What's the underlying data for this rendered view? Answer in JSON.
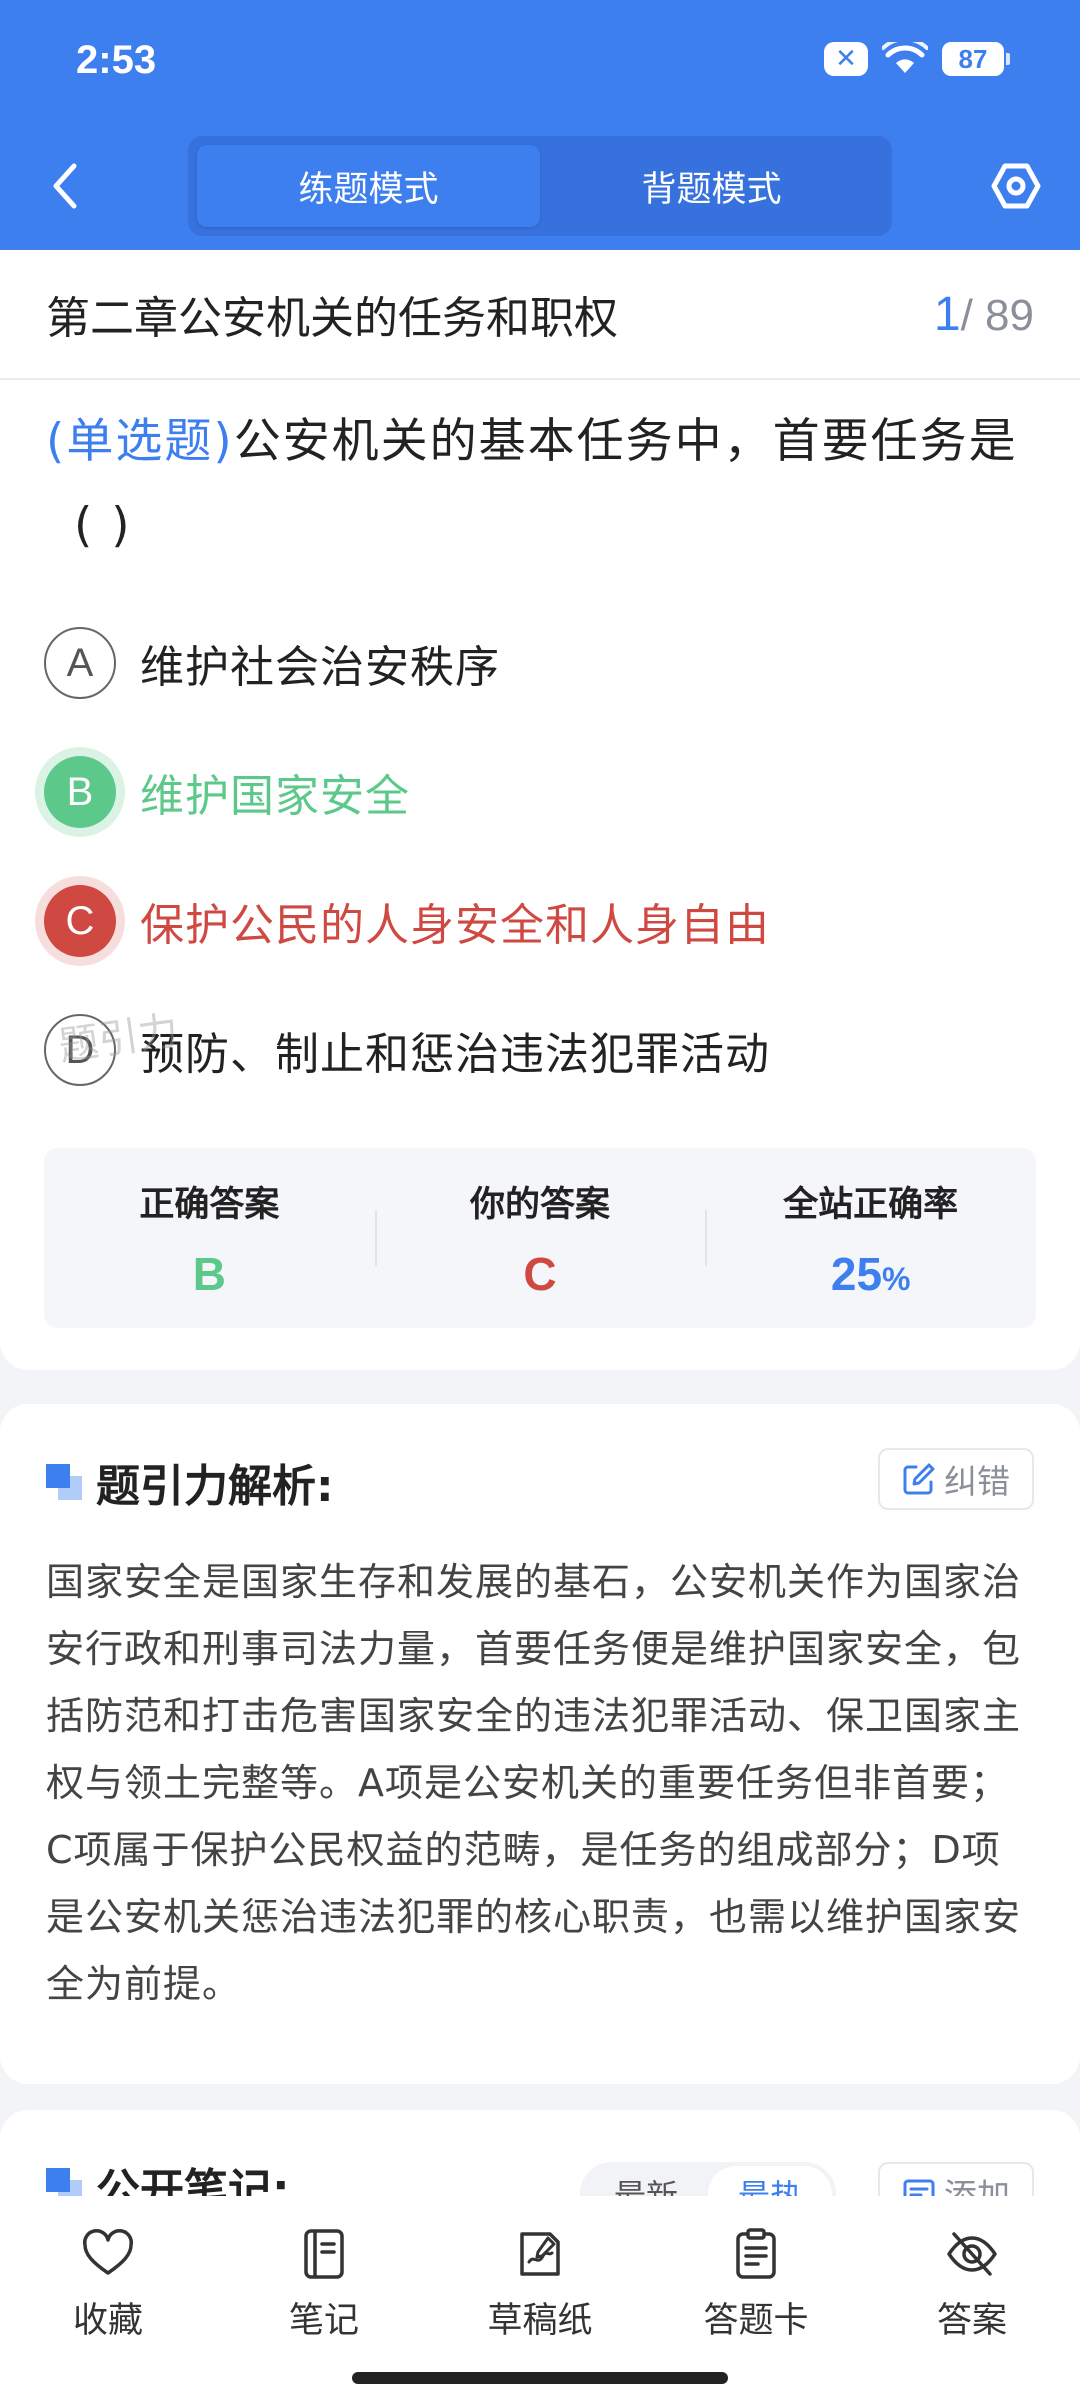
{
  "status_bar": {
    "time": "2:53",
    "dnd_symbol": "✕",
    "battery": "87"
  },
  "header": {
    "modes": [
      {
        "label": "练题模式",
        "active": true
      },
      {
        "label": "背题模式",
        "active": false
      }
    ]
  },
  "chapter": {
    "title": "第二章公安机关的任务和职权",
    "current": "1",
    "total": "/ 89"
  },
  "question": {
    "type": "(单选题)",
    "text": "公安机关的基本任务中，首要任务是",
    "blank": "(        )",
    "options": [
      {
        "letter": "A",
        "text": "维护社会治安秩序",
        "state": "normal"
      },
      {
        "letter": "B",
        "text": "维护国家安全",
        "state": "correct"
      },
      {
        "letter": "C",
        "text": "保护公民的人身安全和人身自由",
        "state": "wrong"
      },
      {
        "letter": "D",
        "text": "预防、制止和惩治违法犯罪活动",
        "state": "normal"
      }
    ]
  },
  "stats": {
    "correct_label": "正确答案",
    "correct_value": "B",
    "yours_label": "你的答案",
    "yours_value": "C",
    "rate_label": "全站正确率",
    "rate_value": "25",
    "rate_unit": "%",
    "watermark": "题引力"
  },
  "analysis": {
    "title": "题引力解析:",
    "report_label": "纠错",
    "text": "国家安全是国家生存和发展的基石，公安机关作为国家治安行政和刑事司法力量，首要任务便是维护国家安全，包括防范和打击危害国家安全的违法犯罪活动、保卫国家主权与领土完整等。A项是公安机关的重要任务但非首要；C项属于保护公民权益的范畴，是任务的组成部分；D项是公安机关惩治违法犯罪的核心职责，也需以维护国家安全为前提。"
  },
  "notes": {
    "title": "公开笔记:",
    "sort_latest": "最新",
    "sort_hot": "最热",
    "add_label": "添加"
  },
  "bottom_nav": [
    {
      "label": "收藏",
      "icon": "heart-icon"
    },
    {
      "label": "笔记",
      "icon": "notebook-icon"
    },
    {
      "label": "草稿纸",
      "icon": "draft-icon"
    },
    {
      "label": "答题卡",
      "icon": "answer-sheet-icon"
    },
    {
      "label": "答案",
      "icon": "eye-off-icon"
    }
  ],
  "colors": {
    "primary": "#3e7ff0",
    "correct": "#5cc88a",
    "wrong": "#cf4942"
  }
}
